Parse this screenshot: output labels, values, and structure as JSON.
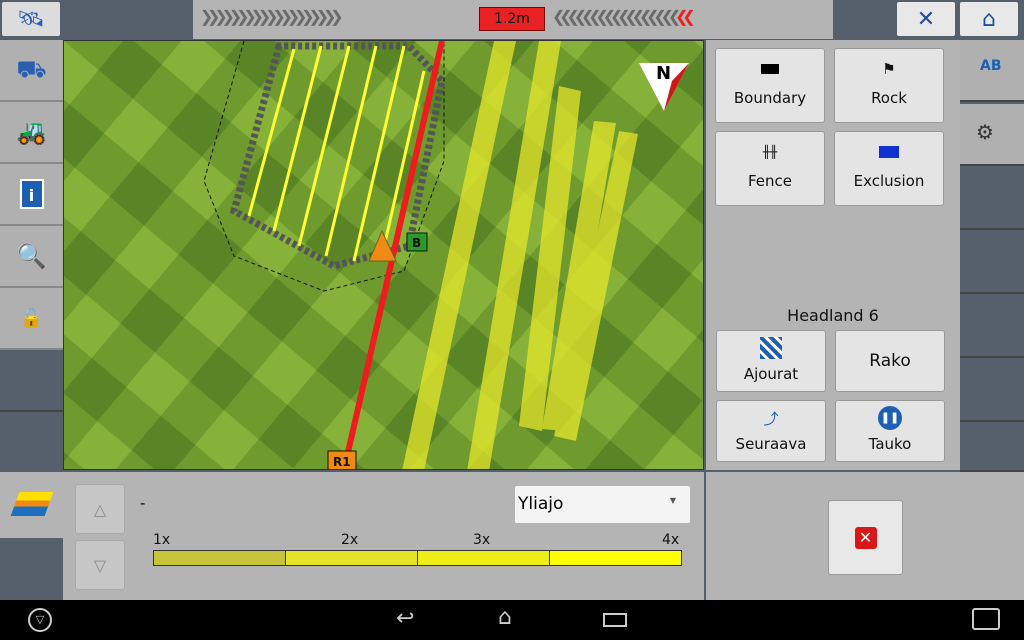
{
  "topbar": {
    "distance": "1.2m",
    "left_icon": "satellite-icon",
    "tools_icon": "wrench-screwdriver-icon",
    "home_icon": "home-icon"
  },
  "left_sidebar": [
    "tractor-implement-icon",
    "tractor-icon",
    "info-icon",
    "magnifier-icon",
    "unlock-icon"
  ],
  "map": {
    "north": "N",
    "marker_b": "B",
    "marker_r1": "R1"
  },
  "right_panel": {
    "buttons": [
      {
        "label": "Boundary",
        "icon": "boundary-icon"
      },
      {
        "label": "Rock",
        "icon": "flag-icon"
      },
      {
        "label": "Fence",
        "icon": "fence-icon"
      },
      {
        "label": "Exclusion",
        "icon": "exclusion-icon"
      }
    ],
    "headland_title": "Headland 6",
    "headland_buttons": [
      {
        "label": "Ajourat",
        "icon": "tramlines-icon"
      },
      {
        "label": "Rako"
      },
      {
        "label": "Seuraava",
        "icon": "path-icon"
      },
      {
        "label": "Tauko",
        "icon": "pause-icon"
      }
    ]
  },
  "bottom": {
    "value": "-",
    "dropdown": "Yliajo",
    "scale": [
      "1x",
      "2x",
      "3x",
      "4x"
    ],
    "scale_colors": [
      "#c8c43a",
      "#e6e42a",
      "#f0ee18",
      "#ffff00"
    ]
  },
  "nav": {
    "back": "back-icon",
    "home": "home-icon",
    "recent": "recent-apps-icon"
  }
}
